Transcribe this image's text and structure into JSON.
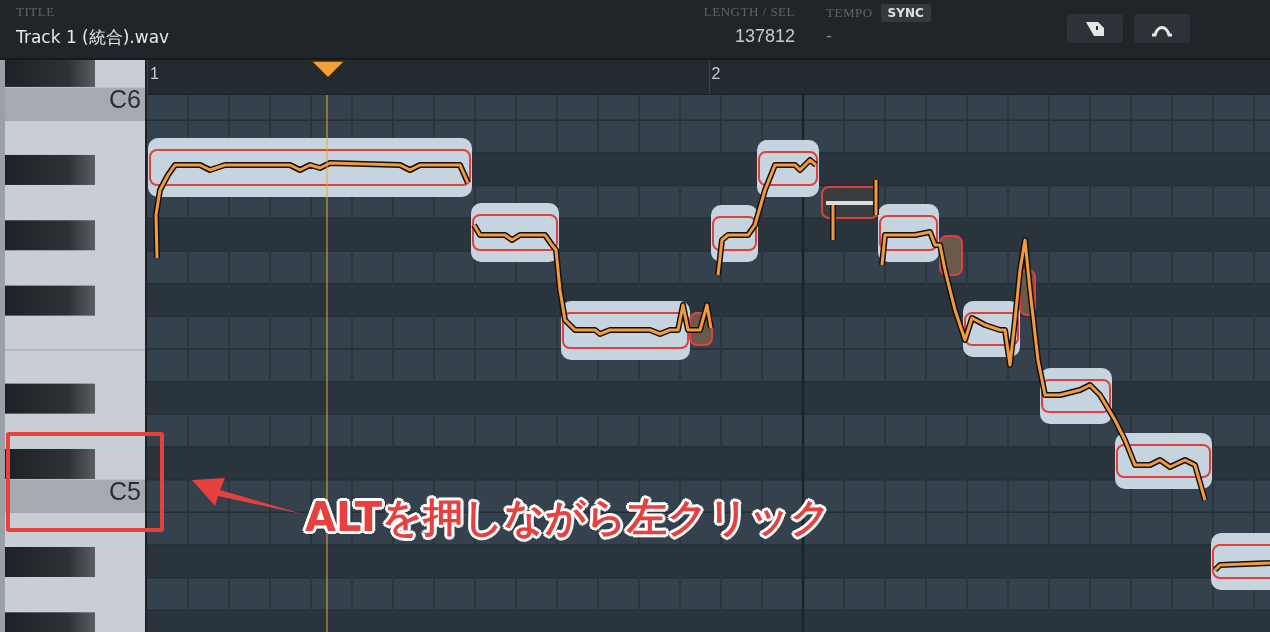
{
  "header": {
    "title_label": "TITLE",
    "title": "Track 1 (統合).wav",
    "length_label": "LENGTH / SEL",
    "length": "137812",
    "tempo_label": "TEMPO",
    "sync_button": "SYNC",
    "tempo": "-"
  },
  "ruler": {
    "bars": [
      "1",
      "2"
    ]
  },
  "piano": {
    "labels": [
      "C6",
      "C5"
    ]
  },
  "annotation": {
    "text": "ALTを押しながら左クリック"
  }
}
